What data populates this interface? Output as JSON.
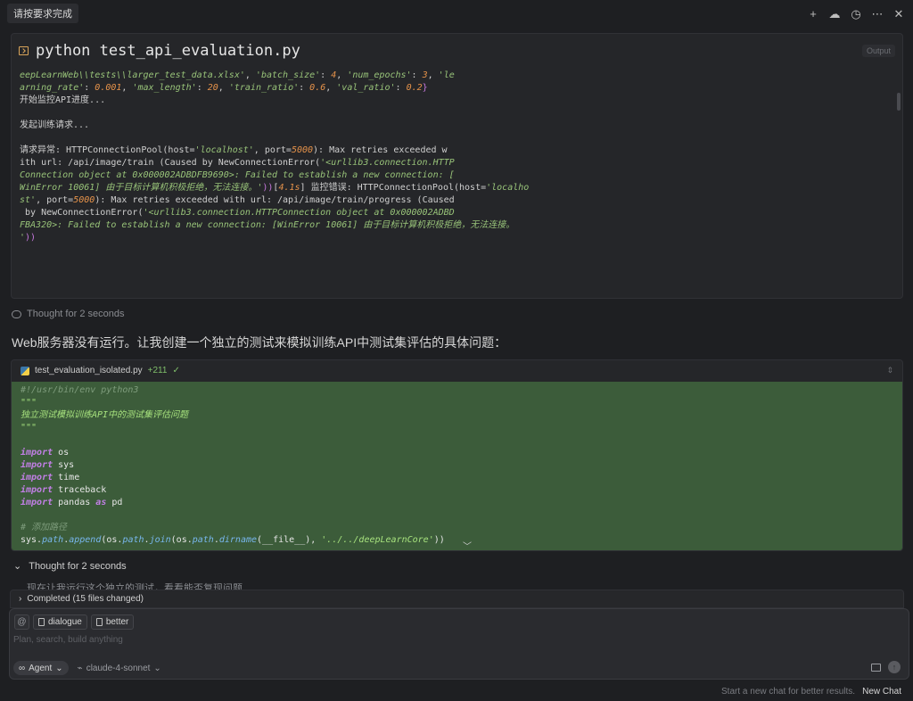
{
  "header": {
    "title": "请按要求完成",
    "icons": [
      "plus-icon",
      "cloud-icon",
      "history-icon",
      "more-icon",
      "close-icon"
    ]
  },
  "terminal": {
    "command": "python test_api_evaluation.py",
    "badge": "Output"
  },
  "thought1": {
    "label": "Thought for 2 seconds"
  },
  "message": {
    "text": "Web服务器没有运行。让我创建一个独立的测试来模拟训练API中测试集评估的具体问题："
  },
  "code_file": {
    "filename": "test_evaluation_isolated.py",
    "added": "+211",
    "check": "✓"
  },
  "thought2": {
    "label": "Thought for 2 seconds",
    "text": "现在让我运行这个独立的测试，看看能否复现问题"
  },
  "completed": {
    "label": "Completed (15 files changed)"
  },
  "input": {
    "at": "@",
    "chips": [
      "dialogue",
      "better"
    ],
    "placeholder": "Plan, search, build anything",
    "agent": "Agent",
    "model": "claude-4-sonnet"
  },
  "footer": {
    "hint": "Start a new chat for better results.",
    "new_chat": "New Chat"
  }
}
